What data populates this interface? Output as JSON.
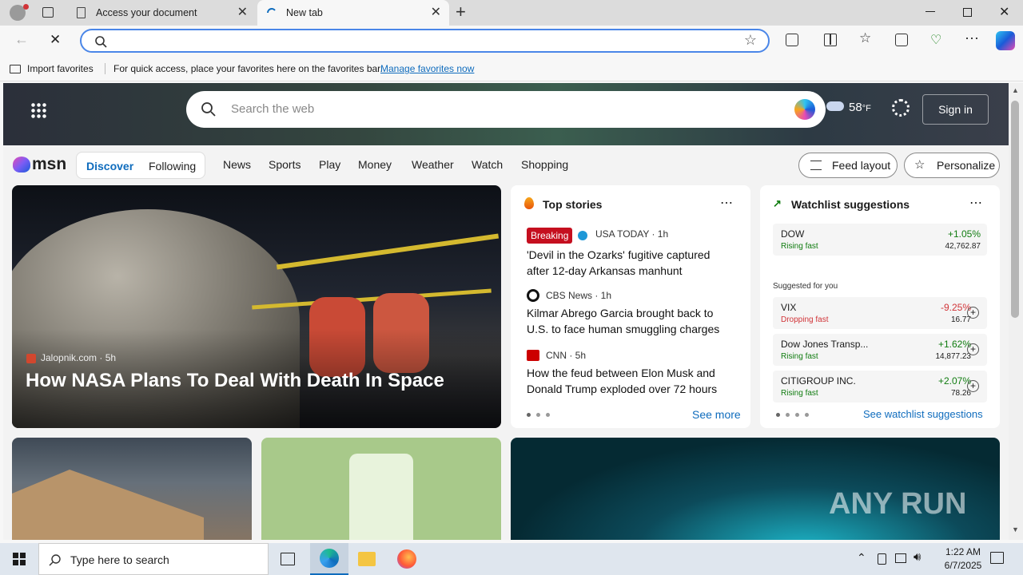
{
  "browser": {
    "tabs": [
      {
        "title": "Access your document"
      },
      {
        "title": "New tab"
      }
    ],
    "favorites_bar": {
      "import_label": "Import favorites",
      "message": "For quick access, place your favorites here on the favorites bar.",
      "manage_link": "Manage favorites now"
    }
  },
  "msn": {
    "search_placeholder": "Search the web",
    "weather_temp": "58",
    "weather_unit": "°F",
    "sign_in": "Sign in",
    "logo": "msn",
    "pills": [
      "Discover",
      "Following"
    ],
    "nav": [
      "News",
      "Sports",
      "Play",
      "Money",
      "Weather",
      "Watch",
      "Shopping"
    ],
    "feed_layout": "Feed layout",
    "personalize": "Personalize",
    "hero": {
      "source": "Jalopnik.com",
      "age": "5h",
      "title": "How NASA Plans To Deal With Death In Space"
    },
    "top_stories": {
      "title": "Top stories",
      "items": [
        {
          "badge": "Breaking",
          "source": "USA TODAY · 1h",
          "title": "'Devil in the Ozarks' fugitive captured after 12-day Arkansas manhunt"
        },
        {
          "source": "CBS News · 1h",
          "title": "Kilmar Abrego Garcia brought back to U.S. to face human smuggling charges"
        },
        {
          "source": "CNN · 5h",
          "title": "How the feud between Elon Musk and Donald Trump exploded over 72 hours"
        }
      ],
      "see_more": "See more"
    },
    "watchlist": {
      "title": "Watchlist suggestions",
      "main": {
        "name": "DOW",
        "status": "Rising fast",
        "change": "+1.05%",
        "value": "42,762.87"
      },
      "suggested_label": "Suggested for you",
      "items": [
        {
          "name": "VIX",
          "status": "Dropping fast",
          "change": "-9.25%",
          "value": "16.77"
        },
        {
          "name": "Dow Jones Transp...",
          "status": "Rising fast",
          "change": "+1.62%",
          "value": "14,877.23"
        },
        {
          "name": "CITIGROUP INC.",
          "status": "Rising fast",
          "change": "+2.07%",
          "value": "78.26"
        }
      ],
      "see_all": "See watchlist suggestions"
    }
  },
  "taskbar": {
    "search_placeholder": "Type here to search",
    "time": "1:22 AM",
    "date": "6/7/2025"
  },
  "watermark": "ANY RUN",
  "colors": {
    "accent": "#0f6cbd",
    "up": "#107c10",
    "down": "#d13438",
    "breaking": "#c50f1f"
  }
}
